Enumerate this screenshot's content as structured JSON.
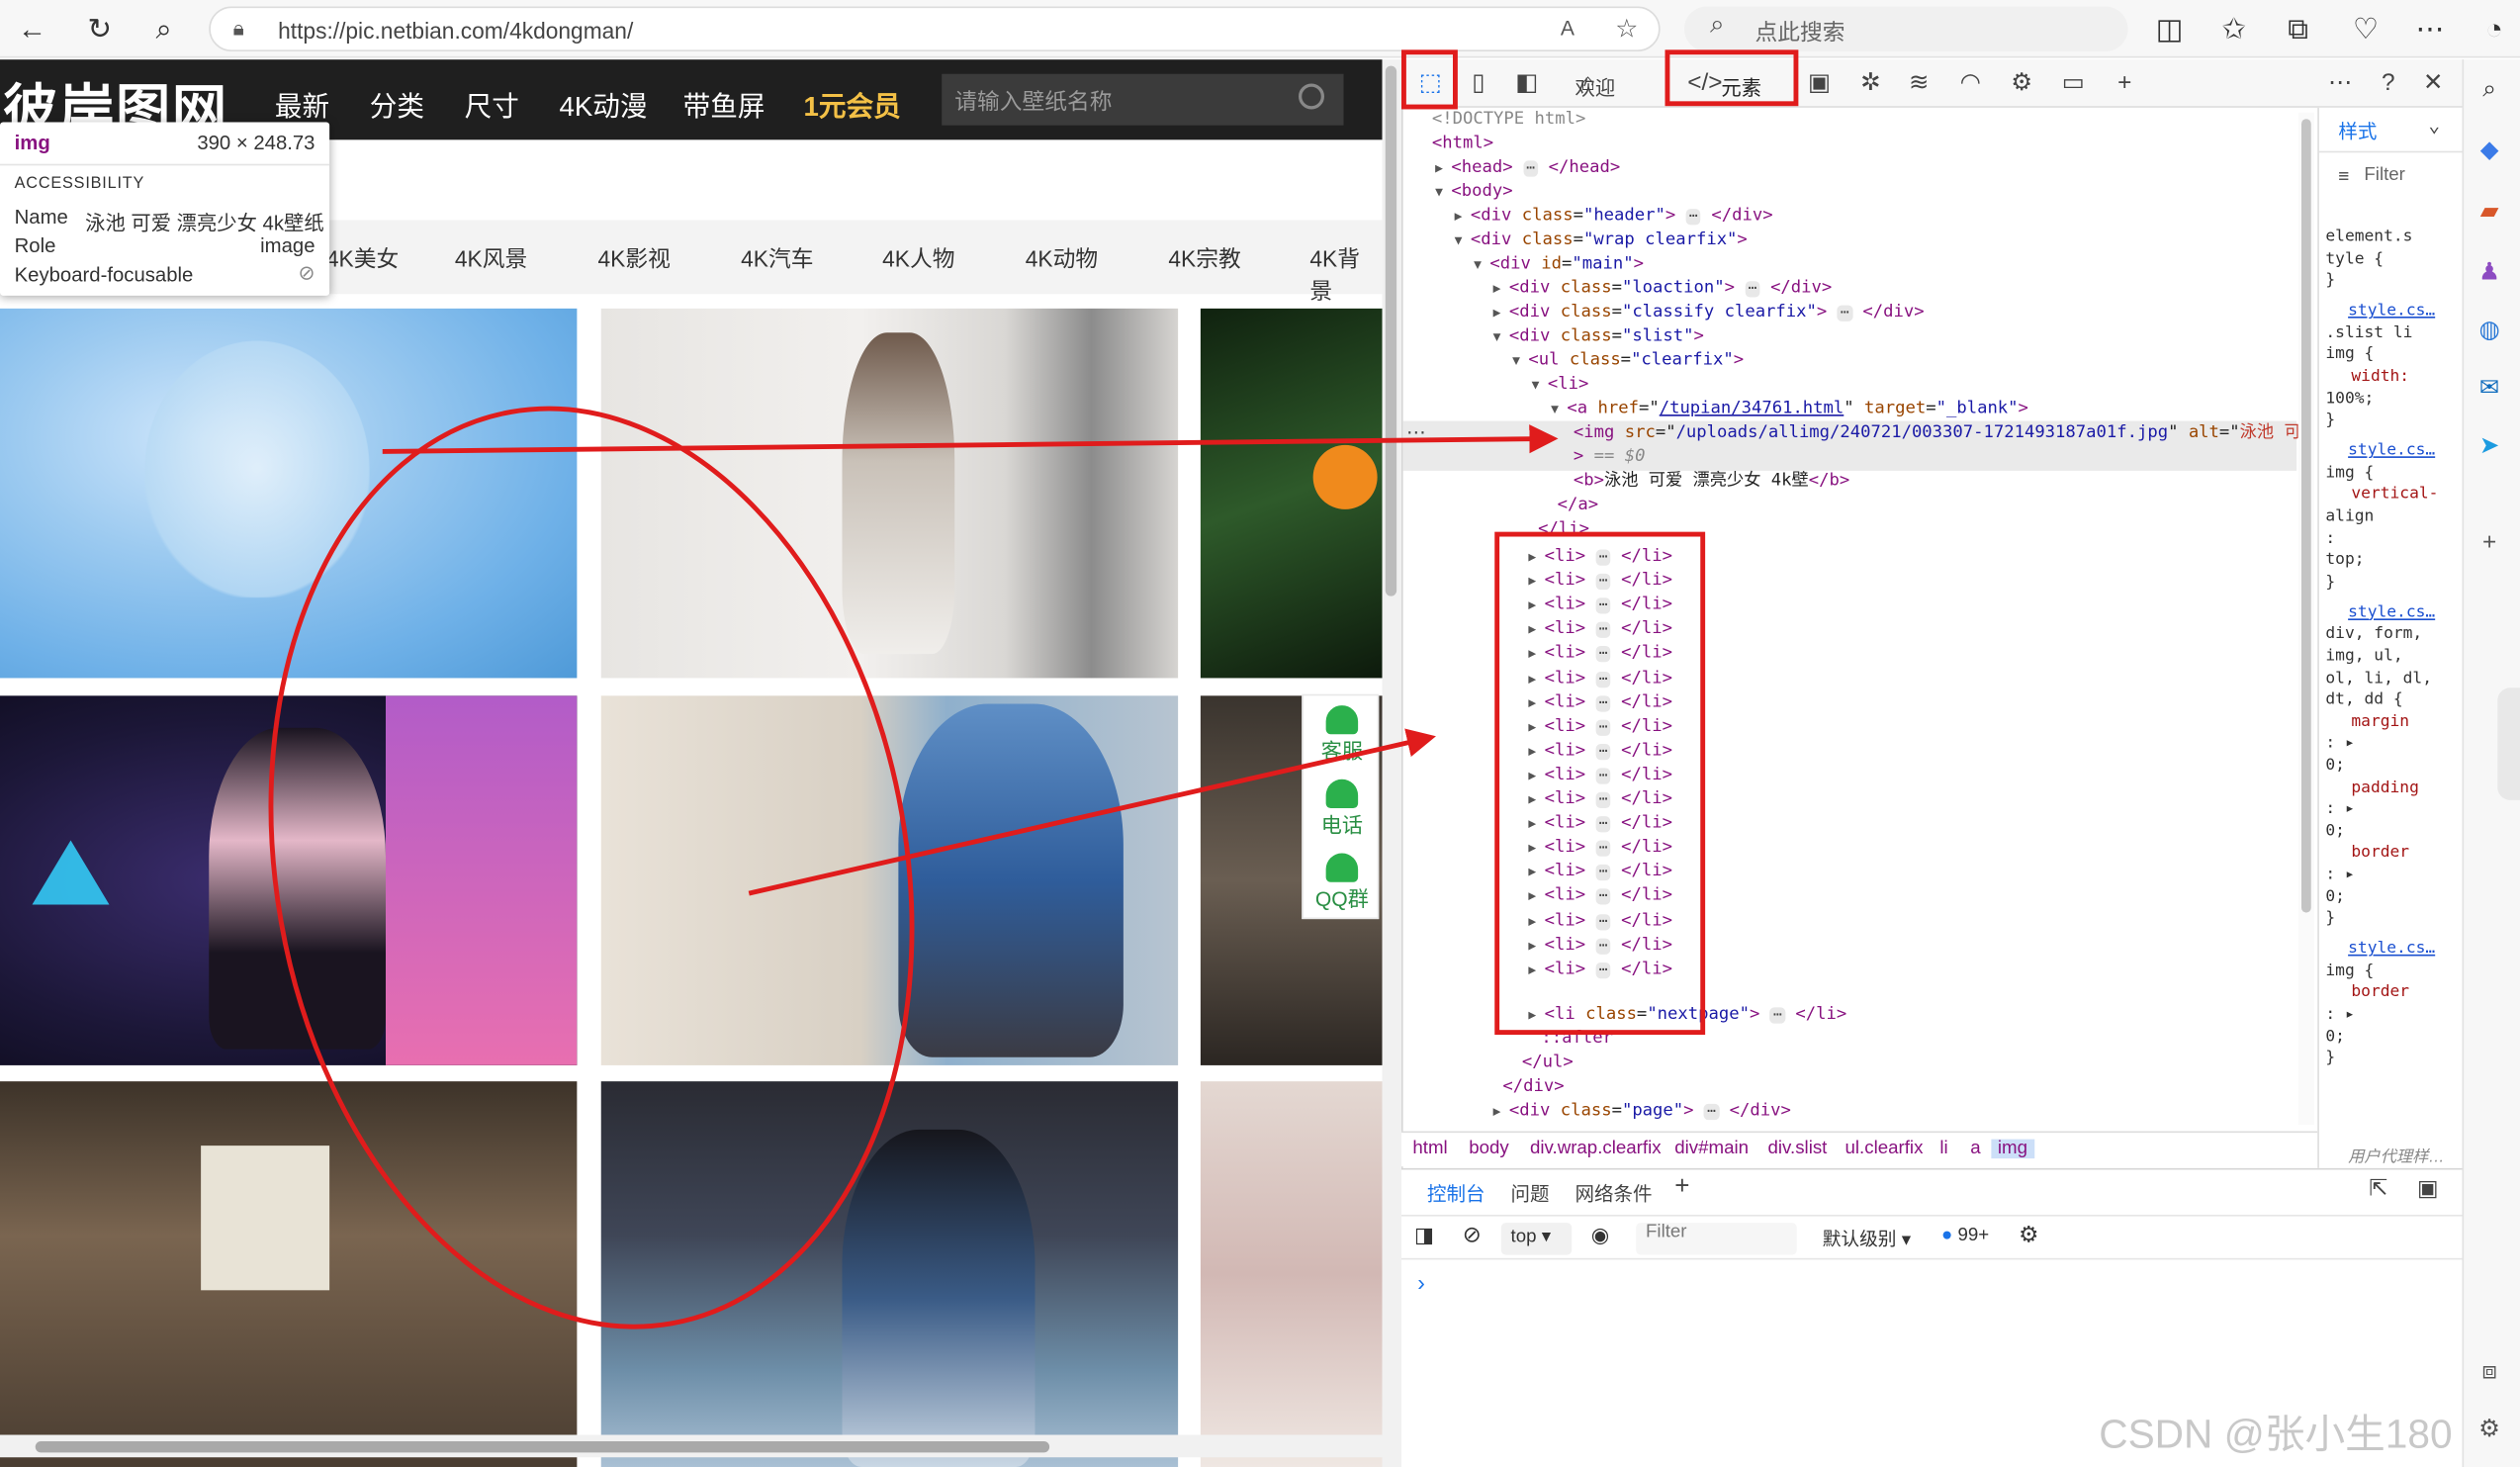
{
  "browser": {
    "url": "https://pic.netbian.com/4kdongman/",
    "search_placeholder": "点此搜索"
  },
  "site": {
    "logo": "彼岸图网",
    "nav": [
      "最新",
      "分类",
      "尺寸",
      "4K动漫",
      "带鱼屏"
    ],
    "vip": "1元会员",
    "search_placeholder": "请输入壁纸名称",
    "categories": [
      "4K美女",
      "4K风景",
      "4K影视",
      "4K汽车",
      "4K人物",
      "4K动物",
      "4K宗教",
      "4K背景"
    ],
    "service": [
      "客服",
      "电话",
      "QQ群"
    ]
  },
  "tooltip": {
    "tag": "img",
    "size": "390 × 248.73",
    "section": "ACCESSIBILITY",
    "name_label": "Name",
    "name_value": "泳池 可爱 漂亮少女 4k壁纸",
    "role_label": "Role",
    "role_value": "image",
    "focus_label": "Keyboard-focusable"
  },
  "devtools": {
    "tabs": {
      "welcome": "欢迎",
      "elements": "元素"
    },
    "dom": {
      "doctype": "<!DOCTYPE html>",
      "html": "<html>",
      "head_open": "<head>",
      "head_close": "</head>",
      "body": "<body>",
      "div": "div",
      "class": "class",
      "id": "id",
      "header_class": "\"header\"",
      "wrap_class": "\"wrap clearfix\"",
      "main_id": "\"main\"",
      "loaction_class": "\"loaction\"",
      "classify_class": "\"classify clearfix\"",
      "slist_class": "\"slist\"",
      "ul_class": "\"clearfix\"",
      "li": "<li>",
      "a_href": "/tupian/34761.html",
      "a_target": "\"_blank\"",
      "img_src": "/uploads/allimg/240721/003307-1721493187a01f.jpg",
      "img_alt": "泳池 可爱 漂亮少女 4k壁纸",
      "eq0": "== $0",
      "b_text": "泳池 可爱 漂亮少女 4k壁",
      "a_close": "</a>",
      "li_close": "</li>",
      "nextpage_class": "\"nextpage\"",
      "after": "::after",
      "ul_close": "</ul>",
      "div_close": "</div>",
      "page_class": "\"page\"",
      "collapsed_li_count": 18
    },
    "breadcrumbs": [
      "html",
      "body",
      "div.wrap.clearfix",
      "div#main",
      "div.slist",
      "ul.clearfix",
      "li",
      "a",
      "img"
    ],
    "styles": {
      "tab": "样式",
      "filter": "Filter",
      "rules": [
        "element.s",
        "tyle {",
        "}",
        "style.cs…",
        ".slist li",
        "img {",
        "width:",
        "100%;",
        "}",
        "style.cs…",
        "img {",
        "vertical-",
        "align",
        ":",
        "top;",
        "}",
        "style.cs…",
        "div, form,",
        "img, ul,",
        "ol, li, dl,",
        "dt, dd {",
        "margin",
        ": ▸",
        "0;",
        "padding",
        ": ▸",
        "0;",
        "border",
        ": ▸",
        "0;",
        "}",
        "style.cs…",
        "img {",
        "border",
        ": ▸",
        "0;",
        "}"
      ],
      "footer": "用户代理样…"
    },
    "drawer": {
      "tabs": [
        "控制台",
        "问题",
        "网络条件"
      ],
      "context": "top",
      "filter": "Filter",
      "level": "默认级别",
      "issues": "99+",
      "prompt": "›"
    }
  },
  "watermark": "CSDN @张小生180",
  "colors": {
    "annotation_red": "#e01c1c",
    "site_bar": "#1f1f1f",
    "vip_gold": "#f3c046"
  }
}
